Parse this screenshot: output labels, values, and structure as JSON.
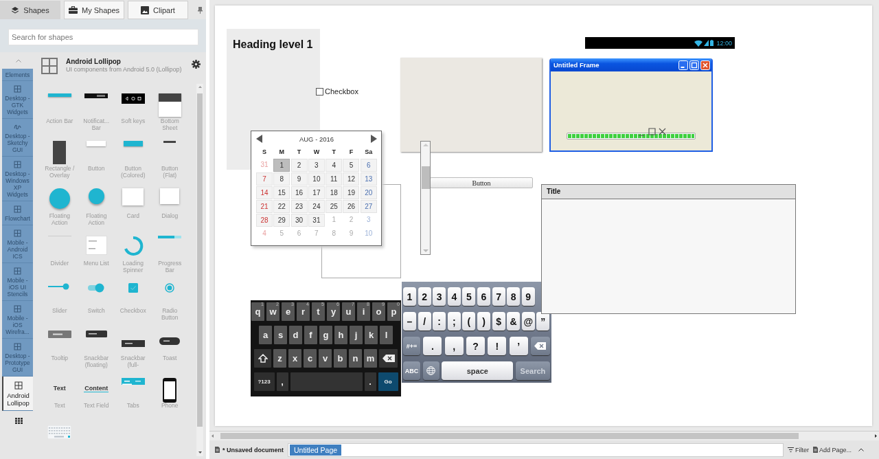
{
  "panel_tabs": [
    {
      "label": "Shapes",
      "selected": true
    },
    {
      "label": "My Shapes",
      "selected": false
    },
    {
      "label": "Clipart",
      "selected": false
    }
  ],
  "search": {
    "placeholder": "Search for shapes"
  },
  "categories": [
    {
      "label": "Elements",
      "selected": false,
      "kind": "cut"
    },
    {
      "label": "Desktop - GTK Widgets",
      "selected": false,
      "kind": "grid"
    },
    {
      "label": "Desktop - Sketchy GUI",
      "selected": false,
      "kind": "sketchy"
    },
    {
      "label": "Desktop - Windows XP Widgets",
      "selected": false,
      "kind": "grid"
    },
    {
      "label": "Flowchart",
      "selected": false,
      "kind": "grid"
    },
    {
      "label": "Mobile - Android ICS",
      "selected": false,
      "kind": "grid"
    },
    {
      "label": "Mobile - iOS UI Stencils",
      "selected": false,
      "kind": "grid"
    },
    {
      "label": "Mobile - iOS Wirefra...",
      "selected": false,
      "kind": "grid"
    },
    {
      "label": "Desktop - Prototype GUI",
      "selected": false,
      "kind": "grid"
    },
    {
      "label": "Android Lollipop",
      "selected": true,
      "kind": "grid"
    }
  ],
  "library": {
    "title": "Android Lollipop",
    "description": "UI components from Android 5.0 (Lollipop)"
  },
  "shapes": [
    {
      "label": "Action Bar",
      "kind": "action-bar"
    },
    {
      "label": "Notificat... Bar",
      "kind": "notification-bar"
    },
    {
      "label": "Soft keys",
      "kind": "soft-keys"
    },
    {
      "label": "Bottom Sheet",
      "kind": "bottom-sheet"
    },
    {
      "label": "Rectangle / Overlay",
      "kind": "rectangle"
    },
    {
      "label": "Button",
      "kind": "button"
    },
    {
      "label": "Button (Colored)",
      "kind": "button-colored"
    },
    {
      "label": "Button (Flat)",
      "kind": "button-flat"
    },
    {
      "label": "Floating Action",
      "kind": "fab"
    },
    {
      "label": "Floating Action",
      "kind": "fab-mini"
    },
    {
      "label": "Card",
      "kind": "card"
    },
    {
      "label": "Dialog",
      "kind": "dialog"
    },
    {
      "label": "Divider",
      "kind": "divider"
    },
    {
      "label": "Menu List",
      "kind": "menu-list"
    },
    {
      "label": "Loading Spinner",
      "kind": "spinner"
    },
    {
      "label": "Progress Bar",
      "kind": "progress"
    },
    {
      "label": "Slider",
      "kind": "slider"
    },
    {
      "label": "Switch",
      "kind": "switch"
    },
    {
      "label": "Checkbox",
      "kind": "checkbox"
    },
    {
      "label": "Radio Button",
      "kind": "radio"
    },
    {
      "label": "Tooltip",
      "kind": "tooltip"
    },
    {
      "label": "Snackbar (floating)",
      "kind": "snackbar-floating"
    },
    {
      "label": "Snackbar (full-",
      "kind": "snackbar-full"
    },
    {
      "label": "Toast",
      "kind": "toast"
    },
    {
      "label": "Text",
      "kind": "text",
      "sample": "Text"
    },
    {
      "label": "Text Field",
      "kind": "text-field",
      "sample": "Content"
    },
    {
      "label": "Tabs",
      "kind": "tabs"
    },
    {
      "label": "Phone",
      "kind": "phone"
    },
    {
      "kind": "keyboard"
    }
  ],
  "canvas": {
    "heading": "Heading level 1",
    "checkbox": {
      "label": "Checkbox",
      "checked": false
    },
    "calendar": {
      "month": "AUG - 2016",
      "weekdays": [
        "S",
        "M",
        "T",
        "W",
        "T",
        "F",
        "Sa"
      ],
      "weeks": [
        [
          {
            "d": "31",
            "outside": true,
            "selected": false
          },
          {
            "d": "1",
            "outside": false,
            "selected": true
          },
          {
            "d": "2",
            "outside": false,
            "selected": false
          },
          {
            "d": "3",
            "outside": false,
            "selected": false
          },
          {
            "d": "4",
            "outside": false,
            "selected": false
          },
          {
            "d": "5",
            "outside": false,
            "selected": false
          },
          {
            "d": "6",
            "outside": false,
            "selected": false
          }
        ],
        [
          {
            "d": "7",
            "outside": false,
            "selected": false
          },
          {
            "d": "8",
            "outside": false,
            "selected": false
          },
          {
            "d": "9",
            "outside": false,
            "selected": false
          },
          {
            "d": "10",
            "outside": false,
            "selected": false
          },
          {
            "d": "11",
            "outside": false,
            "selected": false
          },
          {
            "d": "12",
            "outside": false,
            "selected": false
          },
          {
            "d": "13",
            "outside": false,
            "selected": false
          }
        ],
        [
          {
            "d": "14",
            "outside": false,
            "selected": false
          },
          {
            "d": "15",
            "outside": false,
            "selected": false
          },
          {
            "d": "16",
            "outside": false,
            "selected": false
          },
          {
            "d": "17",
            "outside": false,
            "selected": false
          },
          {
            "d": "18",
            "outside": false,
            "selected": false
          },
          {
            "d": "19",
            "outside": false,
            "selected": false
          },
          {
            "d": "20",
            "outside": false,
            "selected": false
          }
        ],
        [
          {
            "d": "21",
            "outside": false,
            "selected": false
          },
          {
            "d": "22",
            "outside": false,
            "selected": false
          },
          {
            "d": "23",
            "outside": false,
            "selected": false
          },
          {
            "d": "24",
            "outside": false,
            "selected": false
          },
          {
            "d": "25",
            "outside": false,
            "selected": false
          },
          {
            "d": "26",
            "outside": false,
            "selected": false
          },
          {
            "d": "27",
            "outside": false,
            "selected": false
          }
        ],
        [
          {
            "d": "28",
            "outside": false,
            "selected": false
          },
          {
            "d": "29",
            "outside": false,
            "selected": false
          },
          {
            "d": "30",
            "outside": false,
            "selected": false
          },
          {
            "d": "31",
            "outside": false,
            "selected": false
          },
          {
            "d": "1",
            "outside": true,
            "selected": false
          },
          {
            "d": "2",
            "outside": true,
            "selected": false
          },
          {
            "d": "3",
            "outside": true,
            "selected": false
          }
        ],
        [
          {
            "d": "4",
            "outside": true,
            "selected": false
          },
          {
            "d": "5",
            "outside": true,
            "selected": false
          },
          {
            "d": "6",
            "outside": true,
            "selected": false
          },
          {
            "d": "7",
            "outside": true,
            "selected": false
          },
          {
            "d": "8",
            "outside": true,
            "selected": false
          },
          {
            "d": "9",
            "outside": true,
            "selected": false
          },
          {
            "d": "10",
            "outside": true,
            "selected": false
          }
        ]
      ]
    },
    "button": "Button",
    "status_bar": {
      "time": "12:00"
    },
    "frame": {
      "title": "Untitled Frame",
      "progress": {
        "level": 1
      }
    },
    "panel": {
      "title": "Title"
    },
    "android_keyboard": {
      "letter_row_top": [
        {
          "kind": "letter",
          "label": "q",
          "hint": "1"
        },
        {
          "kind": "letter",
          "label": "w",
          "hint": "2"
        },
        {
          "kind": "letter",
          "label": "e",
          "hint": "3"
        },
        {
          "kind": "letter",
          "label": "r",
          "hint": "4"
        },
        {
          "kind": "letter",
          "label": "t",
          "hint": "5"
        },
        {
          "kind": "letter",
          "label": "y",
          "hint": "6"
        },
        {
          "kind": "letter",
          "label": "u",
          "hint": "7"
        },
        {
          "kind": "letter",
          "label": "i",
          "hint": "8"
        },
        {
          "kind": "letter",
          "label": "o",
          "hint": "9"
        },
        {
          "kind": "letter",
          "label": "p",
          "hint": "0"
        }
      ],
      "letter_row_middle": [
        {
          "kind": "letter",
          "label": "a"
        },
        {
          "kind": "letter",
          "label": "s"
        },
        {
          "kind": "letter",
          "label": "d"
        },
        {
          "kind": "letter",
          "label": "f"
        },
        {
          "kind": "letter",
          "label": "g"
        },
        {
          "kind": "letter",
          "label": "h"
        },
        {
          "kind": "letter",
          "label": "j"
        },
        {
          "kind": "letter",
          "label": "k"
        },
        {
          "kind": "letter",
          "label": "l"
        }
      ],
      "letter_row_bottom": [
        {
          "kind": "shift"
        },
        {
          "kind": "letter",
          "label": "z"
        },
        {
          "kind": "letter",
          "label": "x"
        },
        {
          "kind": "letter",
          "label": "c"
        },
        {
          "kind": "letter",
          "label": "v"
        },
        {
          "kind": "letter",
          "label": "b"
        },
        {
          "kind": "letter",
          "label": "n"
        },
        {
          "kind": "letter",
          "label": "m"
        },
        {
          "kind": "backspace"
        }
      ],
      "function_row": [
        {
          "kind": "mode",
          "label": "?123"
        },
        {
          "kind": "punct",
          "label": ","
        },
        {
          "kind": "space"
        },
        {
          "kind": "punct",
          "label": "."
        },
        {
          "kind": "action",
          "label": "Go"
        }
      ]
    },
    "ios_keyboard": {
      "number_row": [
        {
          "kind": "key",
          "label": "1"
        },
        {
          "kind": "key",
          "label": "2"
        },
        {
          "kind": "key",
          "label": "3"
        },
        {
          "kind": "key",
          "label": "4"
        },
        {
          "kind": "key",
          "label": "5"
        },
        {
          "kind": "key",
          "label": "6"
        },
        {
          "kind": "key",
          "label": "7"
        },
        {
          "kind": "key",
          "label": "8"
        },
        {
          "kind": "key",
          "label": "9"
        }
      ],
      "symbol_row": [
        {
          "kind": "key",
          "label": "–"
        },
        {
          "kind": "key",
          "label": "/"
        },
        {
          "kind": "key",
          "label": ":"
        },
        {
          "kind": "key",
          "label": ";"
        },
        {
          "kind": "key",
          "label": "("
        },
        {
          "kind": "key",
          "label": ")"
        },
        {
          "kind": "key",
          "label": "$"
        },
        {
          "kind": "key",
          "label": "&"
        },
        {
          "kind": "key",
          "label": "@"
        },
        {
          "kind": "key",
          "label": "”"
        }
      ],
      "punctuation_row": [
        {
          "kind": "mode",
          "label": "#+="
        },
        {
          "kind": "wide",
          "label": "."
        },
        {
          "kind": "wide",
          "label": ","
        },
        {
          "kind": "wide",
          "label": "?"
        },
        {
          "kind": "wide",
          "label": "!"
        },
        {
          "kind": "wide",
          "label": "’"
        },
        {
          "kind": "backspace"
        }
      ],
      "function_row": [
        {
          "kind": "mode",
          "label": "ABC"
        },
        {
          "kind": "globe"
        },
        {
          "kind": "space",
          "label": "space"
        },
        {
          "kind": "action",
          "label": "Search"
        }
      ]
    }
  },
  "footer": {
    "document": "* Unsaved document",
    "pages": [
      {
        "label": "Untitled Page",
        "selected": true
      }
    ],
    "filter": "Filter",
    "add_page": "Add Page..."
  }
}
